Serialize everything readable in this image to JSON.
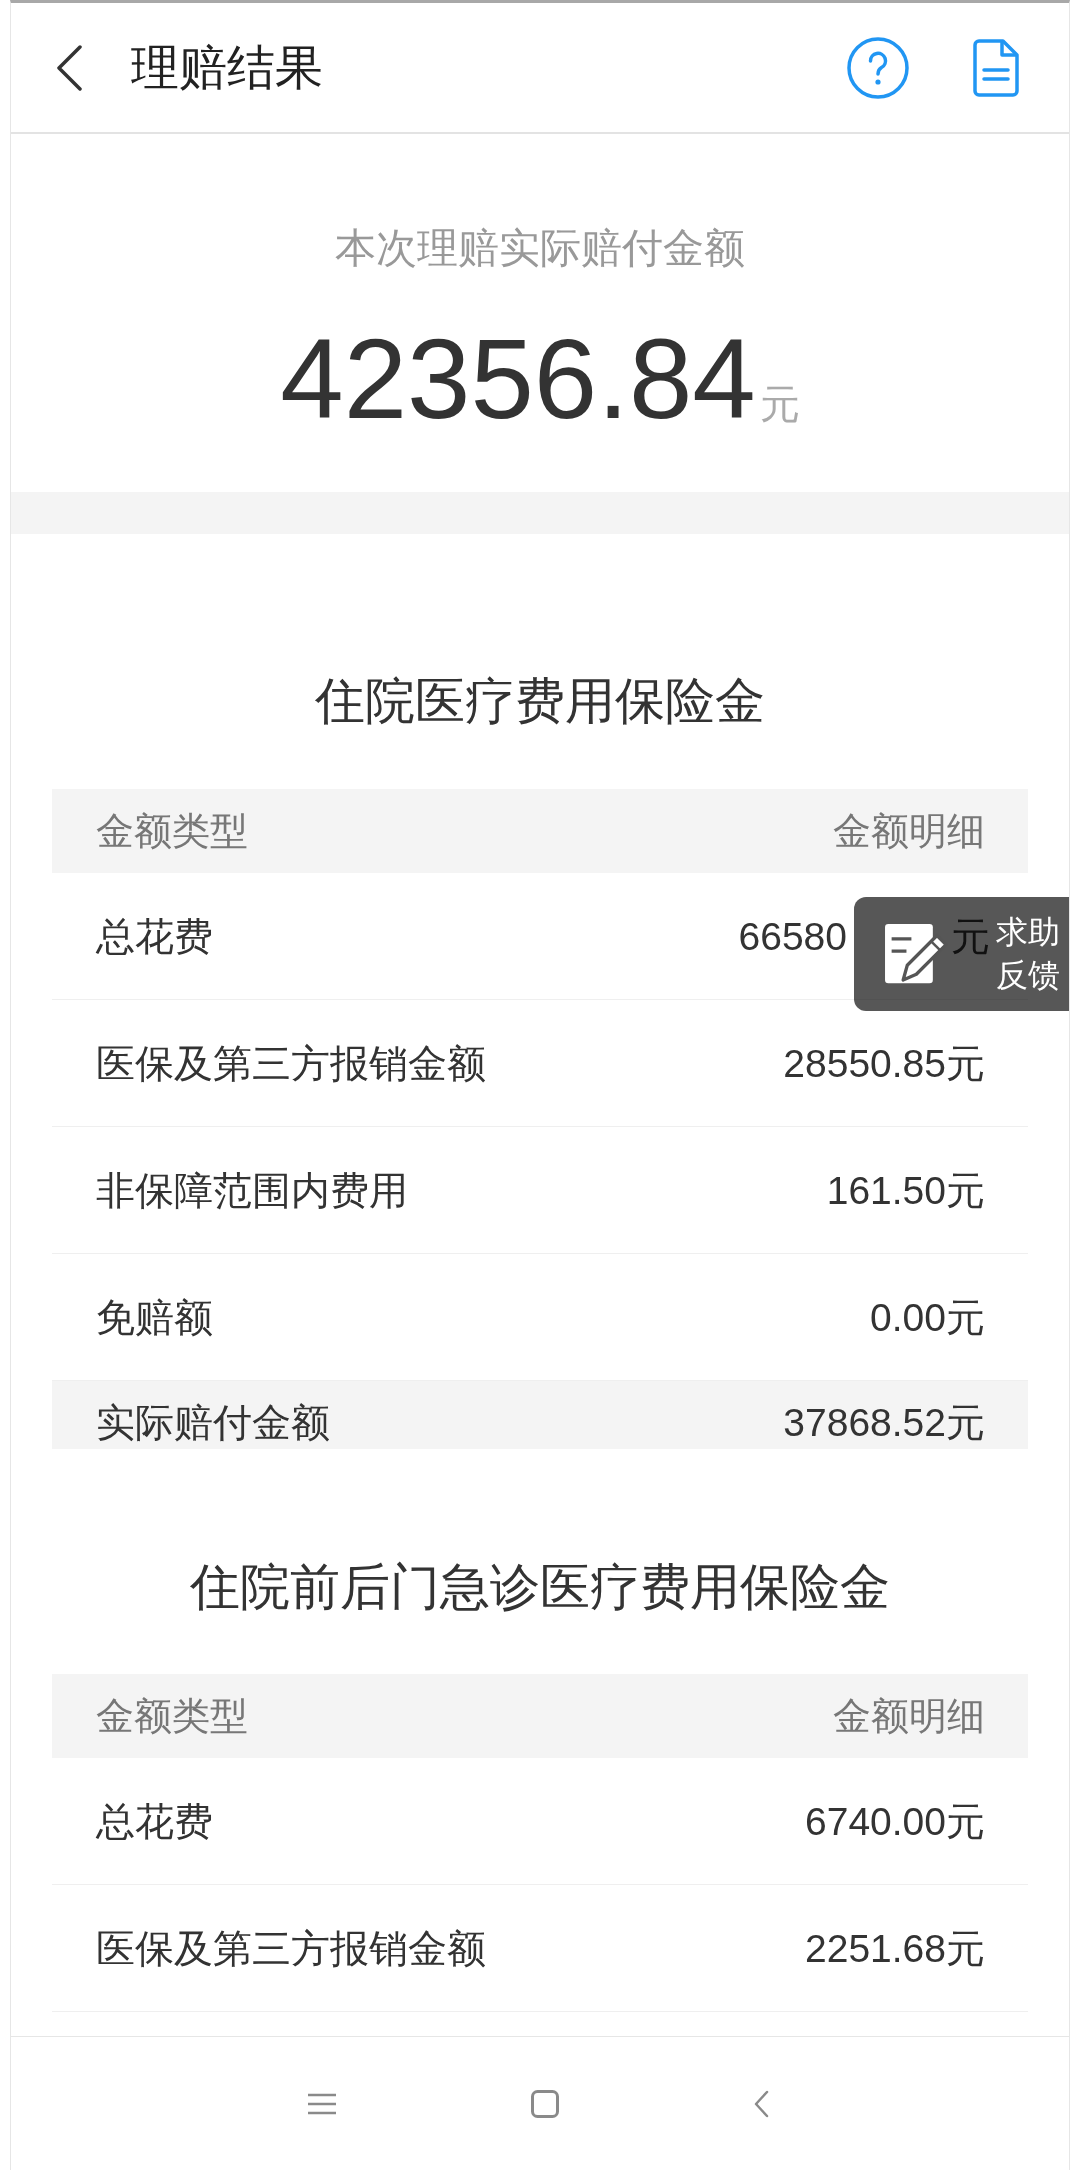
{
  "header": {
    "title": "理赔结果"
  },
  "summary": {
    "caption": "本次理赔实际赔付金额",
    "amount": "42356.84",
    "unit": "元"
  },
  "sections": [
    {
      "title": "住院医疗费用保险金",
      "columns": [
        "金额类型",
        "金额明细"
      ],
      "rows": [
        {
          "kind": "item",
          "label": "总花费",
          "value": "66580",
          "tail": "元"
        },
        {
          "kind": "item",
          "label": "医保及第三方报销金额",
          "value": "28550.85元"
        },
        {
          "kind": "item",
          "label": "非保障范围内费用",
          "value": "161.50元"
        },
        {
          "kind": "item",
          "label": "免赔额",
          "value": "0.00元"
        },
        {
          "kind": "total",
          "label": "实际赔付金额",
          "value": "37868.52元"
        }
      ]
    },
    {
      "title": "住院前后门急诊医疗费用保险金",
      "columns": [
        "金额类型",
        "金额明细"
      ],
      "rows": [
        {
          "kind": "item",
          "label": "总花费",
          "value": "6740.00元"
        },
        {
          "kind": "item",
          "label": "医保及第三方报销金额",
          "value": "2251.68元"
        }
      ]
    }
  ],
  "feedback_button": {
    "lines": [
      "求助",
      "反馈"
    ]
  }
}
